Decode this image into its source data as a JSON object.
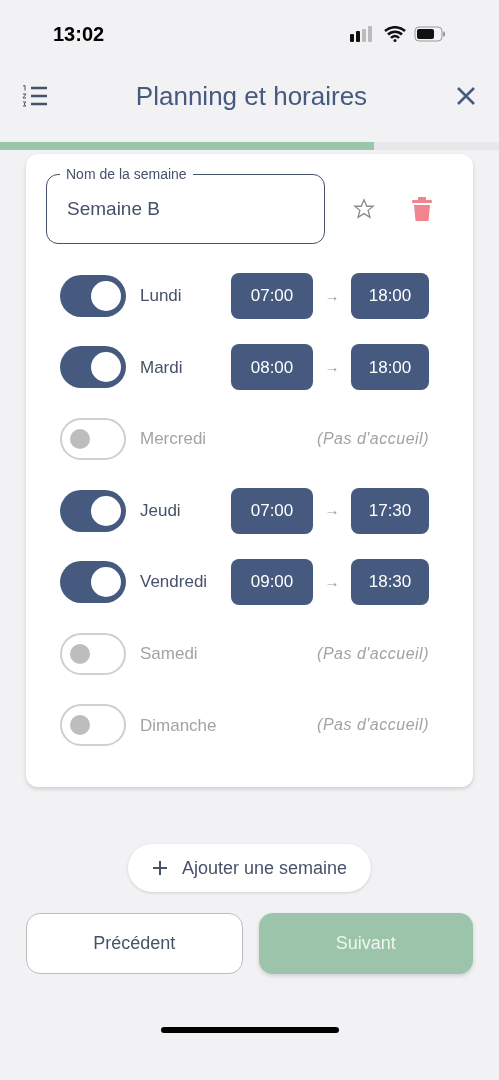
{
  "status_bar": {
    "time": "13:02"
  },
  "header": {
    "title": "Planning et horaires"
  },
  "progress": {
    "level": 0.75
  },
  "week": {
    "label": "Nom de la semaine",
    "value": "Semaine B",
    "favorite": false
  },
  "days": [
    {
      "name": "Lundi",
      "on": true,
      "start": "07:00",
      "end": "18:00",
      "arrow": "→"
    },
    {
      "name": "Mardi",
      "on": true,
      "start": "08:00",
      "end": "18:00",
      "arrow": "→"
    },
    {
      "name": "Mercredi",
      "on": false,
      "note": "(Pas d'accueil)"
    },
    {
      "name": "Jeudi",
      "on": true,
      "start": "07:00",
      "end": "17:30",
      "arrow": "→"
    },
    {
      "name": "Vendredi",
      "on": true,
      "start": "09:00",
      "end": "18:30",
      "arrow": "→"
    },
    {
      "name": "Samedi",
      "on": false,
      "note": "(Pas d'accueil)"
    },
    {
      "name": "Dimanche",
      "on": false,
      "note": "(Pas d'accueil)"
    }
  ],
  "add_button": {
    "label": "Ajouter une semaine"
  },
  "buttons": [
    {
      "label": "Précédent",
      "kind": "secondary"
    },
    {
      "label": "Suivant",
      "kind": "primary"
    }
  ]
}
